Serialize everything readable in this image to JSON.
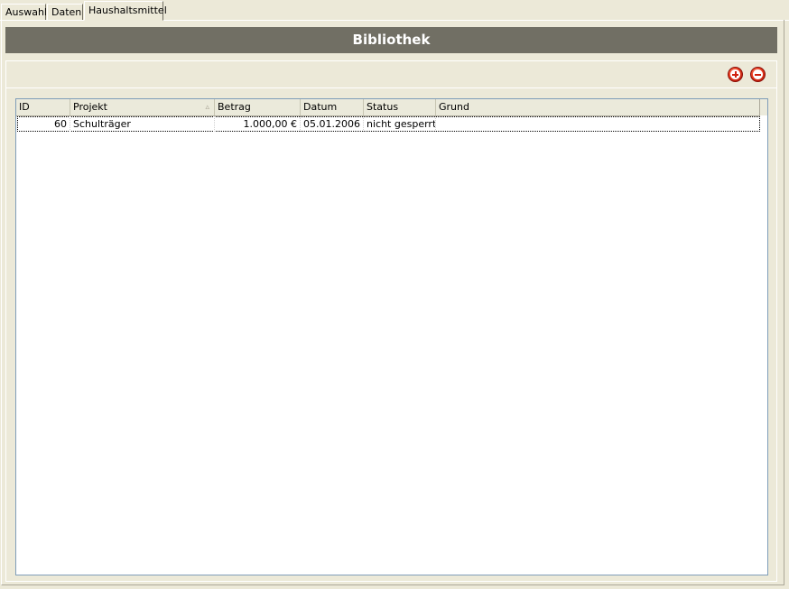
{
  "tabs": [
    {
      "label": "Auswahl"
    },
    {
      "label": "Daten"
    },
    {
      "label": "Haushaltsmittel",
      "active": true
    }
  ],
  "panel": {
    "title": "Bibliothek"
  },
  "toolbar": {
    "add_icon": "add-icon",
    "remove_icon": "remove-icon"
  },
  "table": {
    "columns": [
      "ID",
      "Projekt",
      "Betrag",
      "Datum",
      "Status",
      "Grund"
    ],
    "sorted_column": "Projekt",
    "rows": [
      {
        "id": "60",
        "projekt": "Schulträger",
        "betrag": "1.000,00 €",
        "datum": "05.01.2006",
        "status": "nicht gesperrt",
        "grund": ""
      }
    ]
  },
  "colors": {
    "title_bar": "#716f64",
    "background": "#ece9d8",
    "icon_red": "#e8391c"
  }
}
